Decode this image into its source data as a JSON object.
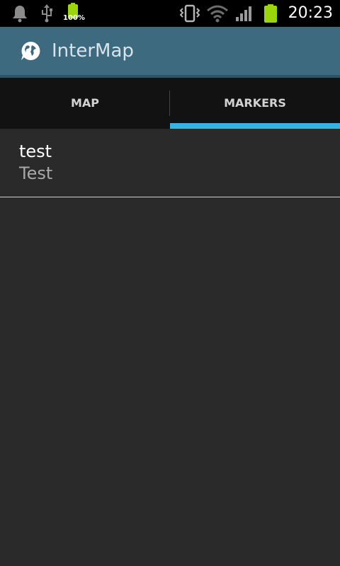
{
  "status_bar": {
    "battery_percent": "100%",
    "time": "20:23",
    "icons": [
      "notification-bell-icon",
      "usb-icon",
      "battery-charging-icon",
      "vibrate-icon",
      "wifi-icon",
      "signal-icon",
      "battery-icon"
    ]
  },
  "action_bar": {
    "title": "InterMap",
    "icon": "globe-chat-icon",
    "background_color": "#3d6a7f"
  },
  "tabs": [
    {
      "label": "MAP",
      "selected": false
    },
    {
      "label": "MARKERS",
      "selected": true
    }
  ],
  "accent_color": "#33b5e5",
  "markers": [
    {
      "title": "test",
      "subtitle": "Test"
    }
  ]
}
